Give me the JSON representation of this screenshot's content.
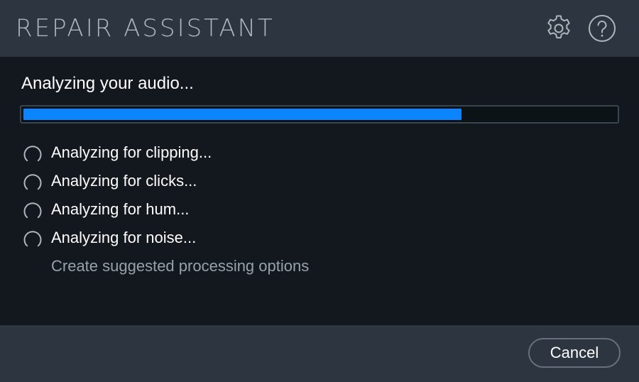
{
  "header": {
    "title": "REPAIR ASSISTANT",
    "settings_icon": "gear-icon",
    "help_icon": "question-circle-icon"
  },
  "main": {
    "status_heading": "Analyzing your audio...",
    "progress_fraction": 0.74,
    "steps": [
      {
        "label": "Analyzing for clipping...",
        "state": "in-progress",
        "icon": "spinner-icon"
      },
      {
        "label": "Analyzing for clicks...",
        "state": "in-progress",
        "icon": "spinner-icon"
      },
      {
        "label": "Analyzing for hum...",
        "state": "in-progress",
        "icon": "spinner-icon"
      },
      {
        "label": "Analyzing for noise...",
        "state": "in-progress",
        "icon": "spinner-icon"
      },
      {
        "label": "Create suggested processing options",
        "state": "pending",
        "icon": ""
      }
    ]
  },
  "footer": {
    "cancel_label": "Cancel"
  },
  "colors": {
    "header_bg": "#2d3640",
    "body_bg": "#12181d",
    "accent": "#0a84ff",
    "title_text": "#aeb6bd",
    "pending_text": "#98a1a9"
  }
}
